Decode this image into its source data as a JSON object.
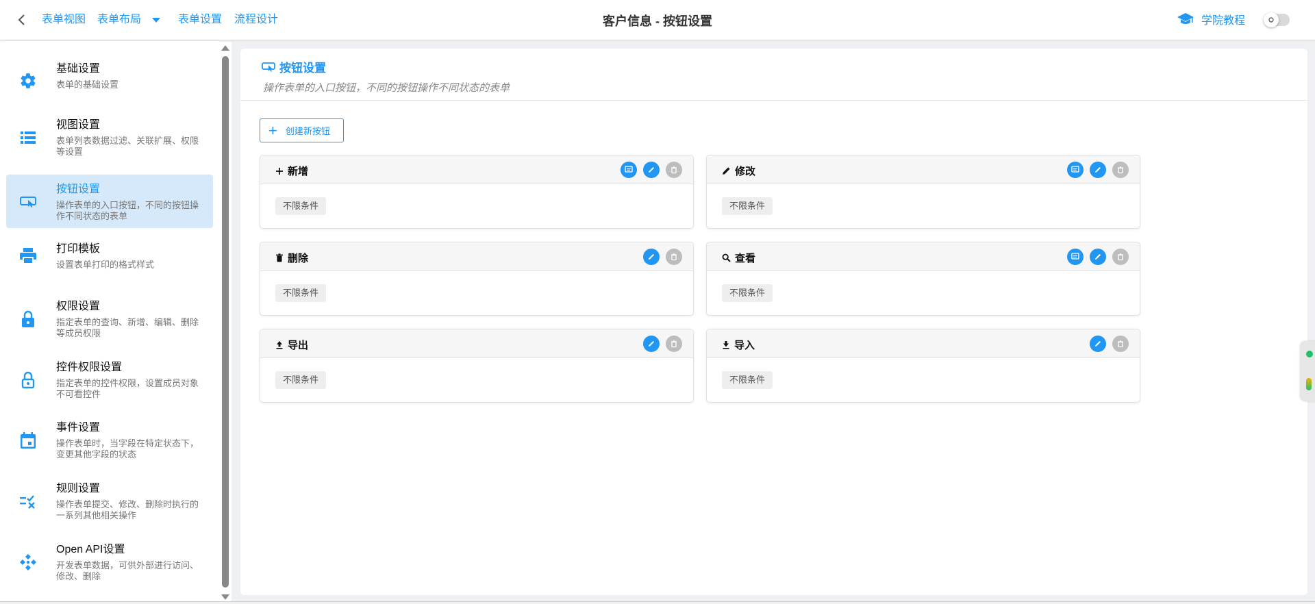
{
  "topbar": {
    "nav": [
      "表单视图",
      "表单布局",
      "表单设置",
      "流程设计"
    ],
    "title": "客户信息 - 按钮设置",
    "academy": "学院教程"
  },
  "sidebar": {
    "items": [
      {
        "title": "基础设置",
        "desc": "表单的基础设置",
        "icon": "gear-icon"
      },
      {
        "title": "视图设置",
        "desc": "表单列表数据过滤、关联扩展、权限等设置",
        "icon": "list-icon"
      },
      {
        "title": "按钮设置",
        "desc": "操作表单的入口按钮，不同的按钮操作不同状态的表单",
        "icon": "button-icon"
      },
      {
        "title": "打印模板",
        "desc": "设置表单打印的格式样式",
        "icon": "printer-icon"
      },
      {
        "title": "权限设置",
        "desc": "指定表单的查询、新增、编辑、删除等成员权限",
        "icon": "lock-icon"
      },
      {
        "title": "控件权限设置",
        "desc": "指定表单的控件权限，设置成员对象不可看控件",
        "icon": "lock-outline-icon"
      },
      {
        "title": "事件设置",
        "desc": "操作表单时，当字段在特定状态下，变更其他字段的状态",
        "icon": "calendar-icon"
      },
      {
        "title": "规则设置",
        "desc": "操作表单提交、修改、删除时执行的一系列其他相关操作",
        "icon": "rule-check-icon"
      },
      {
        "title": "Open API设置",
        "desc": "开发表单数据，可供外部进行访问、修改、删除",
        "icon": "api-icon"
      }
    ],
    "active_index": 2
  },
  "panel": {
    "title": "按钮设置",
    "subtitle": "操作表单的入口按钮，不同的按钮操作不同状态的表单",
    "create_label": "创建新按钮"
  },
  "cards": [
    {
      "name": "新增",
      "icon": "plus-icon",
      "condition": "不限条件",
      "actions": [
        "comment",
        "edit",
        "delete"
      ]
    },
    {
      "name": "修改",
      "icon": "pencil-icon",
      "condition": "不限条件",
      "actions": [
        "comment",
        "edit",
        "delete"
      ]
    },
    {
      "name": "删除",
      "icon": "trash-icon",
      "condition": "不限条件",
      "actions": [
        "edit",
        "delete"
      ]
    },
    {
      "name": "查看",
      "icon": "magnifier-icon",
      "condition": "不限条件",
      "actions": [
        "comment",
        "edit",
        "delete"
      ]
    },
    {
      "name": "导出",
      "icon": "upload-icon",
      "condition": "不限条件",
      "actions": [
        "edit",
        "delete"
      ]
    },
    {
      "name": "导入",
      "icon": "download-icon",
      "condition": "不限条件",
      "actions": [
        "edit",
        "delete"
      ]
    }
  ],
  "colors": {
    "accent": "#2196f3",
    "active_bg": "#d6e9fa",
    "muted": "#bdbdbd"
  }
}
